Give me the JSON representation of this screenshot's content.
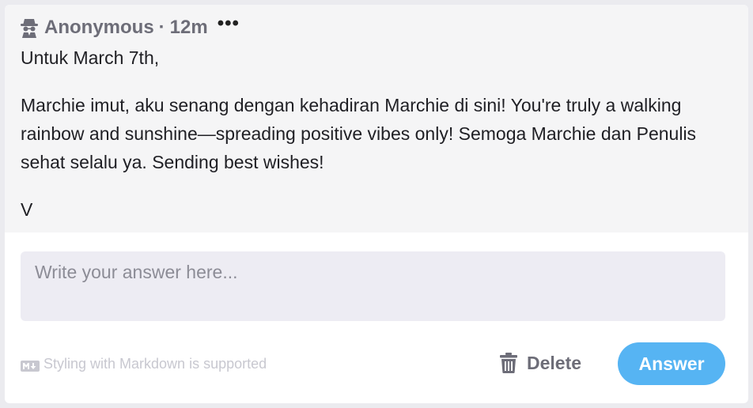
{
  "question": {
    "author": "Anonymous",
    "separator": "·",
    "time_ago": "12m",
    "more_label": "•••",
    "greeting": "Untuk March 7th,",
    "body": "Marchie imut, aku senang dengan kehadiran Marchie di sini! You're truly a walking rainbow and sunshine—spreading positive vibes only! Semoga Marchie dan Penulis sehat selalu ya. Sending best wishes!",
    "signature": "V",
    "author_icon": "spy-icon"
  },
  "answer": {
    "placeholder": "Write your answer here...",
    "value": ""
  },
  "footer": {
    "markdown_note": "Styling with Markdown is supported",
    "markdown_icon": "markdown-icon",
    "delete_label": "Delete",
    "delete_icon": "trash-icon",
    "answer_label": "Answer"
  },
  "colors": {
    "accent": "#56b4f3",
    "question_bg": "#f5f5f6",
    "input_bg": "#edecf3",
    "muted_text": "#6d6d78"
  }
}
